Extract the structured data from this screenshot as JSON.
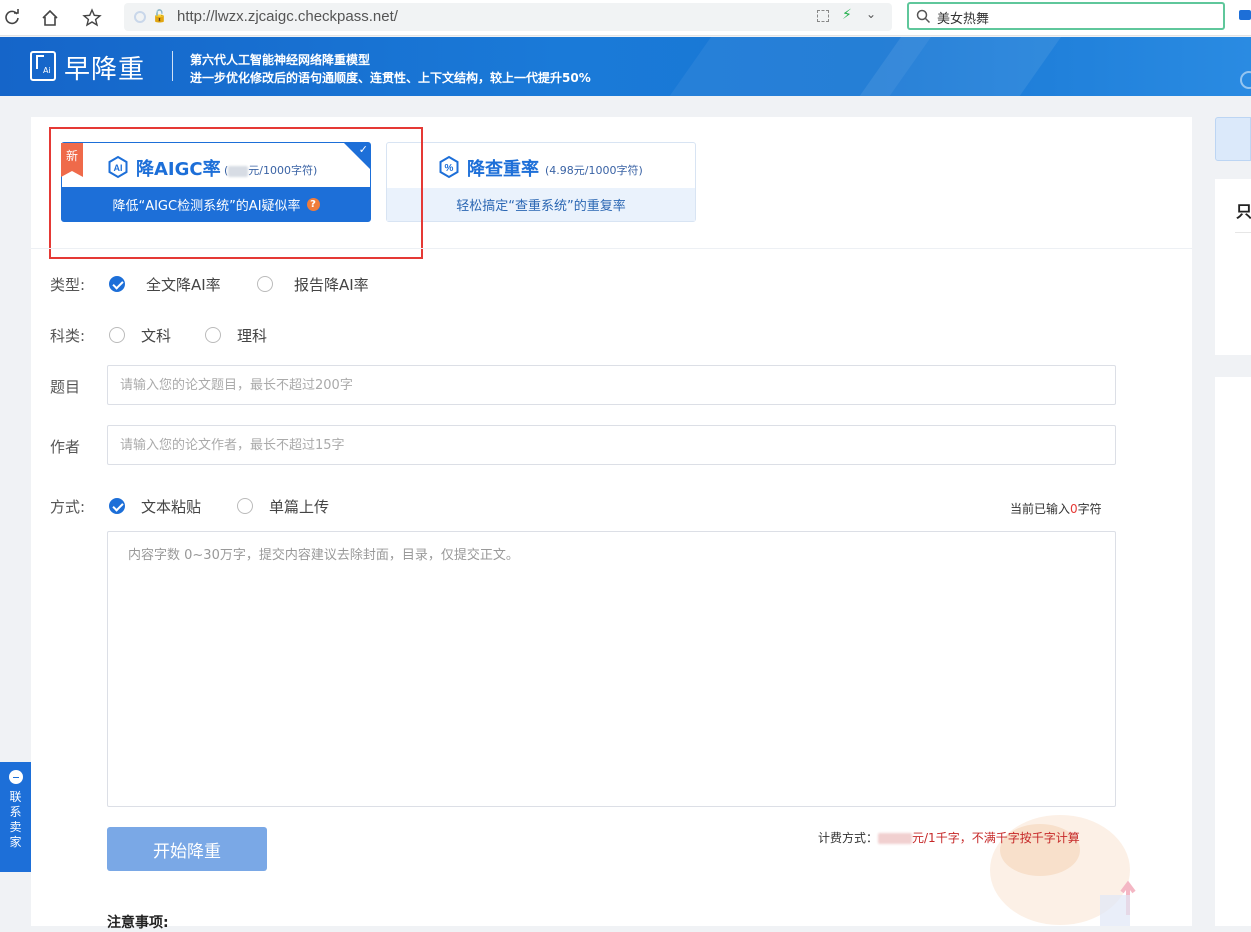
{
  "browser": {
    "url": "http://lwzx.zjcaigc.checkpass.net/",
    "search_value": "美女热舞"
  },
  "header": {
    "logo_text": "早降重",
    "logo_mini": "Ai",
    "tagline_line1": "第六代人工智能神经网络降重模型",
    "tagline_line2": "进一步优化修改后的语句通顺度、连贯性、上下文结构，较上一代提升50%"
  },
  "cards": {
    "aigc": {
      "badge": "新",
      "title": "降AIGC率",
      "price_suffix": "元/1000字符)",
      "description": "降低“AIGC检测系统”的AI疑似率",
      "help": "?"
    },
    "plagiarism": {
      "title": "降查重率",
      "price": "(4.98元/1000字符)",
      "description": "轻松搞定“查重系统”的重复率"
    }
  },
  "form": {
    "type_label": "类型:",
    "type_options": [
      "全文降AI率",
      "报告降AI率"
    ],
    "subject_label": "科类:",
    "subject_options": [
      "文科",
      "理科"
    ],
    "title_label": "题目",
    "title_placeholder": "请输入您的论文题目，最长不超过200字",
    "author_label": "作者",
    "author_placeholder": "请输入您的论文作者，最长不超过15字",
    "method_label": "方式:",
    "method_options": [
      "文本粘贴",
      "单篇上传"
    ],
    "char_count_prefix": "当前已输入",
    "char_count_value": "0",
    "char_count_suffix": "字符",
    "content_placeholder": "内容字数 0~30万字，提交内容建议去除封面，目录，仅提交正文。",
    "submit_label": "开始降重",
    "billing_label": "计费方式：",
    "billing_value": "元/1千字，不满千字按千字计算",
    "notes_title": "注意事项:"
  },
  "side": {
    "contact_label": "联系卖家",
    "right_char": "只"
  },
  "colors": {
    "primary": "#1d6fd8",
    "highlight": "#e53935",
    "badge": "#ef6a4a"
  }
}
